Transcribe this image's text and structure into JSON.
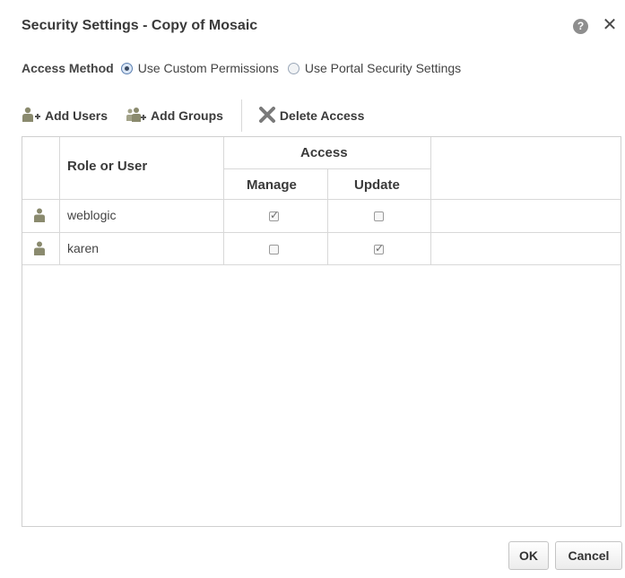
{
  "dialog": {
    "title": "Security Settings - Copy of Mosaic",
    "help_glyph": "?",
    "close_glyph": "✕"
  },
  "access": {
    "label": "Access Method",
    "options": [
      {
        "label": "Use Custom Permissions",
        "selected": true
      },
      {
        "label": "Use Portal Security Settings",
        "selected": false
      }
    ]
  },
  "toolbar": {
    "add_users": "Add Users",
    "add_groups": "Add Groups",
    "delete_access": "Delete Access"
  },
  "table": {
    "col_role": "Role or User",
    "col_access": "Access",
    "col_manage": "Manage",
    "col_update": "Update",
    "rows": [
      {
        "name": "weblogic",
        "manage": true,
        "update": false,
        "icon": "user-icon"
      },
      {
        "name": "karen",
        "manage": false,
        "update": true,
        "icon": "user-icon"
      }
    ]
  },
  "footer": {
    "ok": "OK",
    "cancel": "Cancel"
  },
  "colors": {
    "border": "#cfcfcf",
    "text": "#3a3a3a",
    "checkbox": "#9a9a9a"
  }
}
